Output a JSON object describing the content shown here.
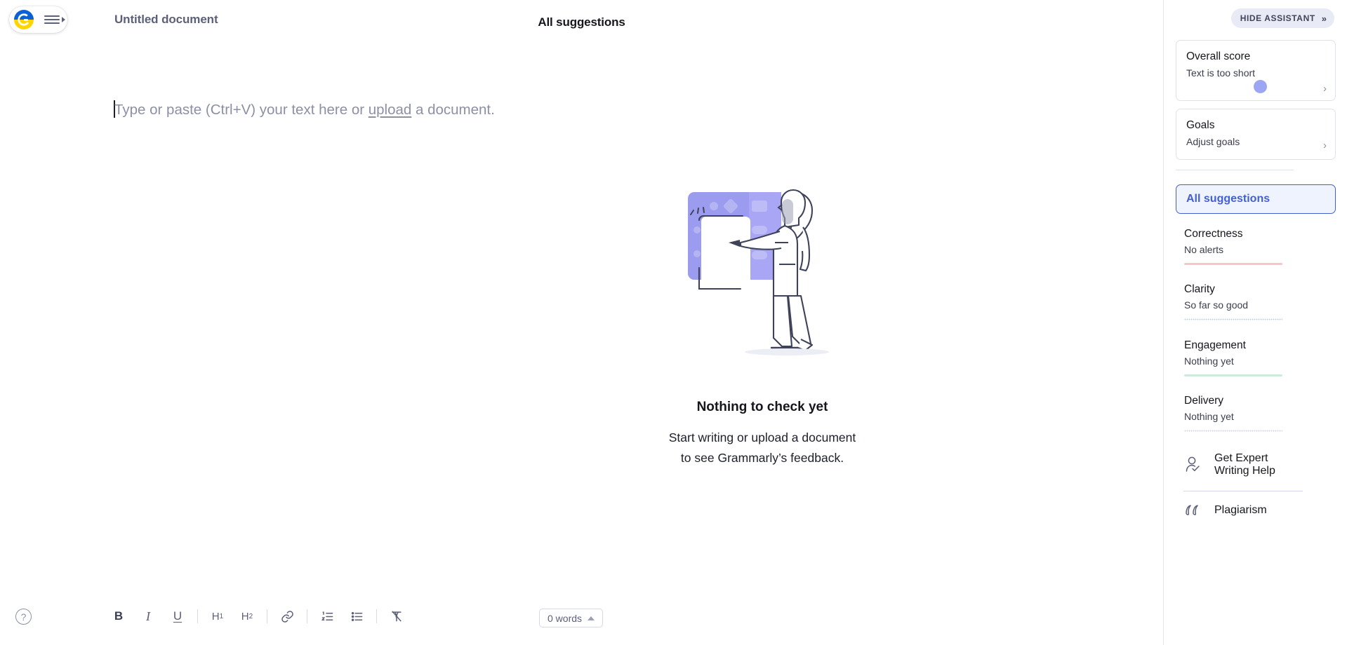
{
  "app": {
    "name": "Grammarly Editor",
    "logo_icon": "grammarly-g-logo",
    "menu_icon": "hamburger-menu-icon",
    "accent_blue": "#4460d0",
    "logo_blue": "#0a61d6",
    "logo_yellow": "#ffd500"
  },
  "header": {
    "document_title": "Untitled document",
    "suggestions_header": "All suggestions"
  },
  "editor": {
    "placeholder_prefix": "Type or paste (Ctrl+V) your text here or ",
    "placeholder_link": "upload",
    "placeholder_suffix": " a document.",
    "content": ""
  },
  "empty_state": {
    "illustration": "woman-pointing-at-screen-illustration",
    "title": "Nothing to check yet",
    "line1": "Start writing or upload a document",
    "line2": "to see Grammarly’s feedback."
  },
  "toolbar": {
    "help_icon": "question-mark-icon",
    "help_label": "?",
    "items": [
      {
        "name": "bold-button",
        "label": "B",
        "icon": "bold-icon"
      },
      {
        "name": "italic-button",
        "label": "I",
        "icon": "italic-icon"
      },
      {
        "name": "underline-button",
        "label": "U",
        "icon": "underline-icon"
      },
      {
        "name": "heading-1-button",
        "label": "H",
        "sub": "1",
        "icon": "heading-1-icon"
      },
      {
        "name": "heading-2-button",
        "label": "H",
        "sub": "2",
        "icon": "heading-2-icon"
      },
      {
        "name": "link-button",
        "label": "",
        "icon": "link-icon"
      },
      {
        "name": "numbered-list-button",
        "label": "",
        "icon": "numbered-list-icon"
      },
      {
        "name": "bullet-list-button",
        "label": "",
        "icon": "bullet-list-icon"
      },
      {
        "name": "clear-formatting-button",
        "label": "",
        "icon": "clear-formatting-icon"
      }
    ],
    "word_count": "0 words",
    "word_count_caret_icon": "chevron-up-icon"
  },
  "sidebar": {
    "hide_assistant_label": "HIDE ASSISTANT",
    "hide_assistant_icon": "double-chevron-right-icon",
    "cards": [
      {
        "name": "overall-score-card",
        "title": "Overall score",
        "subtitle": "Text is too short",
        "chevron_icon": "chevron-right-icon"
      },
      {
        "name": "goals-card",
        "title": "Goals",
        "subtitle": "Adjust goals",
        "chevron_icon": "chevron-right-icon"
      }
    ],
    "active_tab": "All suggestions",
    "metrics": [
      {
        "name": "Correctness",
        "value": "No alerts",
        "color": "#f6c6ca",
        "style": "solid"
      },
      {
        "name": "Clarity",
        "value": "So far so good",
        "color": "#b9d4ef",
        "style": "dotted"
      },
      {
        "name": "Engagement",
        "value": "Nothing yet",
        "color": "#cdeadd",
        "style": "solid"
      },
      {
        "name": "Delivery",
        "value": "Nothing yet",
        "color": "#d7d2ee",
        "style": "dotted"
      }
    ],
    "links": [
      {
        "name": "get-expert-writing-help",
        "label_line1": "Get Expert",
        "label_line2": "Writing Help",
        "icon": "person-check-icon"
      },
      {
        "name": "plagiarism",
        "label_line1": "Plagiarism",
        "label_line2": "",
        "icon": "quotation-marks-icon"
      }
    ]
  },
  "cursor": {
    "visible": true,
    "color": "#6070eb"
  }
}
